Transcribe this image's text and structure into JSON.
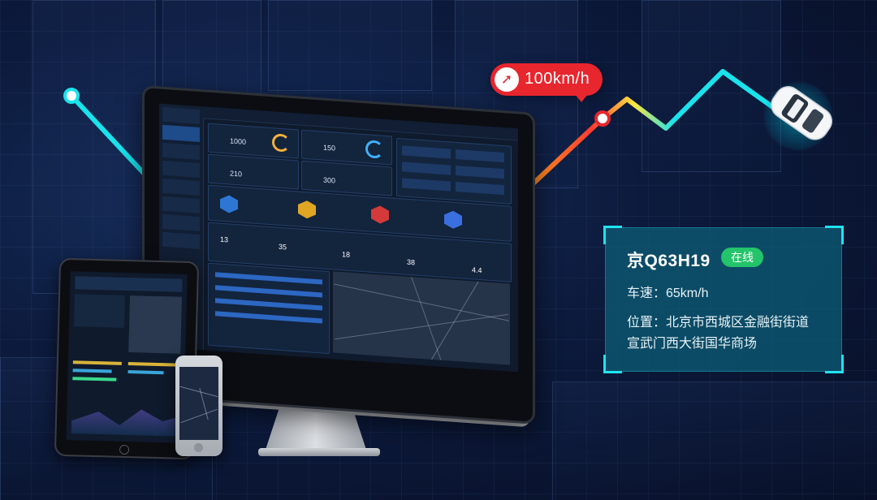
{
  "speed_bubble": {
    "value": "100km/h",
    "icon": "rocket-icon"
  },
  "vehicle": {
    "plate": "京Q63H19",
    "status": "在线",
    "speed_line": "车速：65km/h",
    "location_line1": "位置：北京市西城区金融街街道",
    "location_line2": "宣武门西大街国华商场"
  },
  "colors": {
    "route": "#19e3ec",
    "accent_red": "#e8262e",
    "status_green": "#24c46a",
    "panel_border": "#1fe3ef"
  },
  "dashboard": {
    "stats": [
      "1000",
      "150",
      "210",
      "300"
    ],
    "counts": [
      "13",
      "35",
      "18",
      "38",
      "4.4"
    ]
  }
}
